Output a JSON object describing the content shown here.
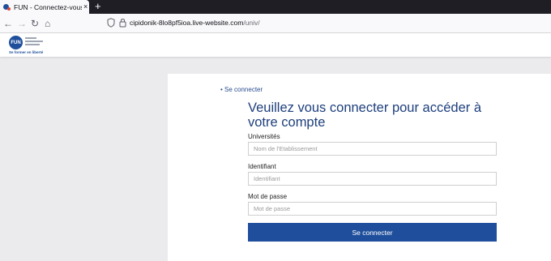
{
  "browser": {
    "tab_title": "FUN - Connectez-vous à votre compte",
    "tab_close": "×",
    "new_tab": "+",
    "url_host": "cipidonik-8lo8pf5ioa.live-website.com",
    "url_path": "/univ/",
    "back": "←",
    "forward": "→",
    "reload": "↻",
    "home": "⌂"
  },
  "header": {
    "logo_text": "FUN",
    "tagline": "Se former en liberté"
  },
  "login": {
    "breadcrumb": "• Se connecter",
    "title": "Veuillez vous connecter pour accéder à votre compte",
    "universities_label": "Universités",
    "universities_placeholder": "Nom de l'Etablissement",
    "username_label": "Identifiant",
    "username_placeholder": "Identifiant",
    "password_label": "Mot de passe",
    "password_placeholder": "Mot de passe",
    "submit_label": "Se connecter"
  },
  "colors": {
    "brand": "#1f4f9c",
    "title": "#1e3f7c",
    "link": "#2a4d8f"
  },
  "icons": [
    "shield-icon",
    "lock-icon",
    "back-arrow-icon",
    "forward-arrow-icon",
    "reload-icon",
    "home-icon",
    "close-icon",
    "plus-icon"
  ]
}
